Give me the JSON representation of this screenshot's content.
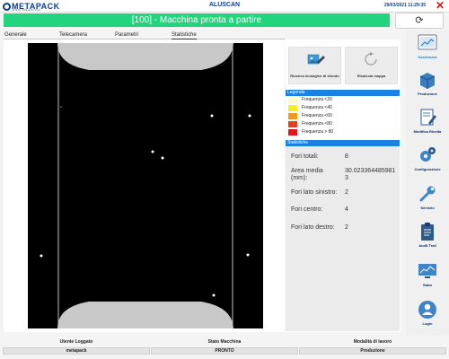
{
  "header": {
    "logo_text": "METAPACK",
    "logo_sub": "ENGINEERING",
    "app_title": "ALUSCAN",
    "datetime": "29/03/2021 11:29:35",
    "close_glyph": "✕"
  },
  "status": {
    "message": "[100] - Macchina pronta a partire",
    "color": "#22d57d",
    "refresh_glyph": "⟳"
  },
  "tabs": [
    {
      "label": "Generale",
      "active": false
    },
    {
      "label": "Telecamera",
      "active": false
    },
    {
      "label": "Parametri",
      "active": false
    },
    {
      "label": "Statistiche",
      "active": true
    }
  ],
  "actions": {
    "reload_image": {
      "label": "Ricarica immagine di sfondo",
      "icon": "image-refresh-icon"
    },
    "recalc_map": {
      "label": "Ricalcola mappa",
      "icon": "reload-icon"
    }
  },
  "legend": {
    "title": "Legenda",
    "items": [
      {
        "label": "Frequenza <20",
        "color": "#fbfbc8"
      },
      {
        "label": "Frequenza <40",
        "color": "#f7ee18"
      },
      {
        "label": "Frequenza <60",
        "color": "#f39a1a"
      },
      {
        "label": "Frequenza <80",
        "color": "#ea3d1a"
      },
      {
        "label": "Frequenza > 80",
        "color": "#e0161a"
      }
    ]
  },
  "statistics": {
    "title": "Statistiche",
    "rows": [
      {
        "label": "Fori totali:",
        "value": "8"
      },
      {
        "label": "Area media (mm):",
        "value": "30.0233644859813"
      },
      {
        "label": "Fori lato sinistro:",
        "value": "2"
      },
      {
        "label": "Fori centro:",
        "value": "4"
      },
      {
        "label": "Fori lato destro:",
        "value": "2"
      }
    ]
  },
  "sidebar": {
    "items": [
      {
        "label": "Dashboard",
        "icon": "dashboard-icon",
        "active": true
      },
      {
        "label": "Produzione",
        "icon": "box-icon",
        "active": false
      },
      {
        "label": "Modifica Ricetta",
        "icon": "edit-document-icon",
        "active": false
      },
      {
        "label": "Configurazione",
        "icon": "gears-icon",
        "active": false
      },
      {
        "label": "Servizio",
        "icon": "wrench-icon",
        "active": false
      },
      {
        "label": "Audit Trail",
        "icon": "clipboard-icon",
        "active": false
      },
      {
        "label": "Stato",
        "icon": "monitor-icon",
        "active": false
      },
      {
        "label": "Login",
        "icon": "user-icon",
        "active": false
      }
    ]
  },
  "footer": {
    "user_title": "Utente Loggato",
    "user_value": "metapack",
    "machine_title": "Stato Macchina",
    "machine_value": "PRONTO",
    "mode_title": "Modalità di lavoro",
    "mode_value": "Produzione"
  },
  "scan": {
    "background": "#000000",
    "hole_count": 8
  }
}
